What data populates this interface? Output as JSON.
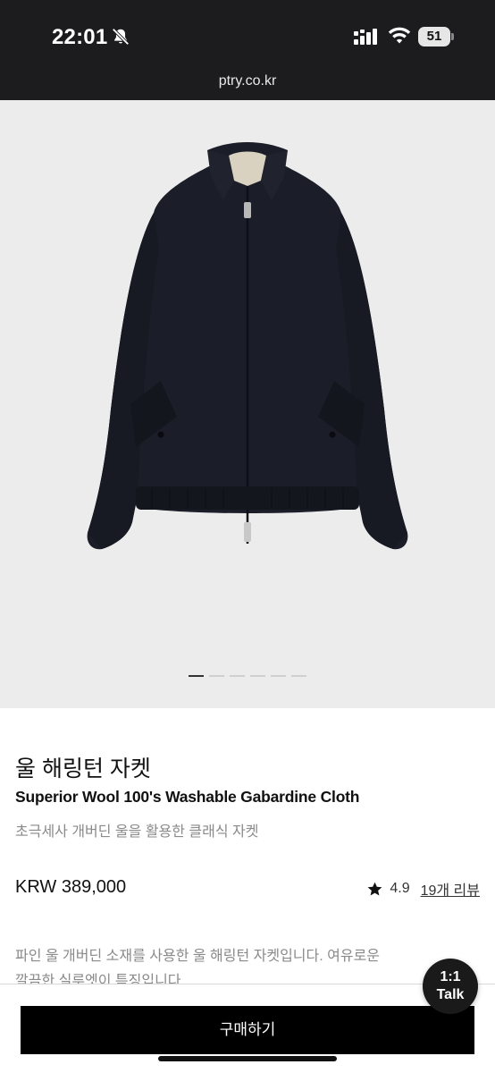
{
  "status_bar": {
    "time": "22:01",
    "battery": "51",
    "icons": [
      "bell-slash-icon",
      "signal-icon",
      "wifi-icon",
      "battery-icon"
    ]
  },
  "browser": {
    "url": "ptry.co.kr"
  },
  "gallery": {
    "image_subject": "navy-wool-harrington-jacket",
    "pages": 6,
    "active_page": 1
  },
  "product": {
    "title": "울 해링턴 자켓",
    "subtitle": "Superior Wool 100's Washable Gabardine Cloth",
    "description": "초극세사 개버딘 울을 활용한 클래식 자켓",
    "price": "KRW 389,000",
    "rating": "4.9",
    "reviews": "19개 리뷰",
    "body_line1": "파인 울 개버딘 소재를 사용한 울 해링턴 자켓입니다. 여유로운",
    "body_line2": "깔끔한 실루엣이 특징입니다."
  },
  "chat": {
    "line1": "1:1",
    "line2": "Talk"
  },
  "cta": {
    "buy_label": "구매하기"
  },
  "colors": {
    "status_bar_bg": "#1c1c1e",
    "hero_bg": "#ececec",
    "jacket": "#1b1e29",
    "button_bg": "#000000",
    "muted_text": "#8a8a8a"
  }
}
